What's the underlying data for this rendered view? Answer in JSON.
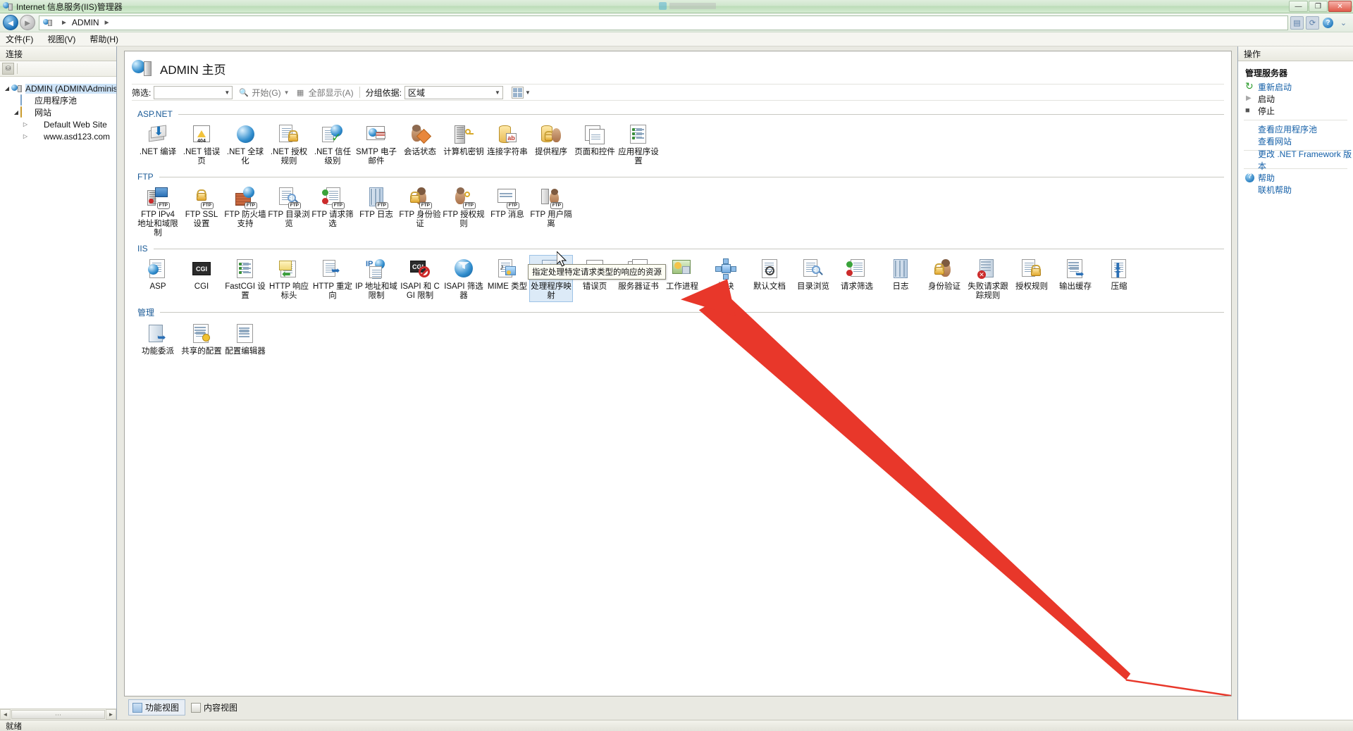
{
  "window": {
    "title": "Internet 信息服务(IIS)管理器",
    "icon": "iis-server-icon",
    "caption_buttons": [
      "minimize",
      "maximize",
      "close"
    ],
    "minimize_glyph": "—",
    "maximize_glyph": "❐",
    "close_glyph": "✕"
  },
  "address_bar": {
    "back_glyph": "◄",
    "forward_glyph": "►",
    "crumb_icon": "server-icon",
    "crumb": "ADMIN",
    "sep_glyph": "►",
    "icons": [
      "panel-icon",
      "refresh-icon",
      "help-icon",
      "chevron-icon"
    ]
  },
  "menu": {
    "items": [
      {
        "label": "文件(F)"
      },
      {
        "label": "视图(V)"
      },
      {
        "label": "帮助(H)"
      }
    ]
  },
  "left_pane": {
    "header": "连接",
    "toolbar_icons": [
      "connect-icon"
    ],
    "tree": [
      {
        "label": "ADMIN (ADMIN\\Administr",
        "icon": "server-icon",
        "depth": 0,
        "expander": "▲",
        "selected": true
      },
      {
        "label": "应用程序池",
        "icon": "app-pool-icon",
        "depth": 1,
        "expander": ""
      },
      {
        "label": "网站",
        "icon": "sites-folder-icon",
        "depth": 1,
        "expander": "▲"
      },
      {
        "label": "Default Web Site",
        "icon": "website-icon",
        "depth": 2,
        "expander": "▷"
      },
      {
        "label": "www.asd123.com",
        "icon": "website-icon",
        "depth": 2,
        "expander": "▷"
      }
    ],
    "hscroll": {
      "left_glyph": "◄",
      "right_glyph": "►",
      "grip": "⋯"
    }
  },
  "main": {
    "page_title": "ADMIN 主页",
    "page_icon": "server-home-icon",
    "filter_bar": {
      "filter_label": "筛选:",
      "filter_value": "",
      "filter_dropdown_glyph": "▼",
      "go_label": "开始(G)",
      "go_icon": "binoculars-icon",
      "go_dropdown_glyph": "▼",
      "show_all_label": "全部显示(A)",
      "show_all_icon": "show-all-icon",
      "group_by_label": "分组依据:",
      "group_by_value": "区域",
      "group_by_dropdown_glyph": "▼",
      "view_dropdown_glyph": "▼"
    },
    "groups": [
      {
        "name": "ASP.NET",
        "items": [
          {
            "label": ".NET 编译",
            "icon": "net-compilation-icon"
          },
          {
            "label": ".NET 错误页",
            "icon": "net-error-pages-icon"
          },
          {
            "label": ".NET 全球化",
            "icon": "net-globalization-icon"
          },
          {
            "label": ".NET 授权规则",
            "icon": "net-authorization-rules-icon"
          },
          {
            "label": ".NET 信任级别",
            "icon": "net-trust-levels-icon"
          },
          {
            "label": "SMTP 电子邮件",
            "icon": "smtp-email-icon"
          },
          {
            "label": "会话状态",
            "icon": "session-state-icon"
          },
          {
            "label": "计算机密钥",
            "icon": "machine-key-icon"
          },
          {
            "label": "连接字符串",
            "icon": "connection-strings-icon"
          },
          {
            "label": "提供程序",
            "icon": "providers-icon"
          },
          {
            "label": "页面和控件",
            "icon": "pages-and-controls-icon"
          },
          {
            "label": "应用程序设置",
            "icon": "application-settings-icon"
          }
        ]
      },
      {
        "name": "FTP",
        "items": [
          {
            "label": "FTP IPv4 地址和域限制",
            "icon": "ftp-ipv4-restrictions-icon"
          },
          {
            "label": "FTP SSL 设置",
            "icon": "ftp-ssl-settings-icon"
          },
          {
            "label": "FTP 防火墙支持",
            "icon": "ftp-firewall-support-icon"
          },
          {
            "label": "FTP 目录浏览",
            "icon": "ftp-directory-browsing-icon"
          },
          {
            "label": "FTP 请求筛选",
            "icon": "ftp-request-filtering-icon"
          },
          {
            "label": "FTP 日志",
            "icon": "ftp-logging-icon"
          },
          {
            "label": "FTP 身份验证",
            "icon": "ftp-authentication-icon"
          },
          {
            "label": "FTP 授权规则",
            "icon": "ftp-authorization-rules-icon"
          },
          {
            "label": "FTP 消息",
            "icon": "ftp-messages-icon"
          },
          {
            "label": "FTP 用户隔离",
            "icon": "ftp-user-isolation-icon"
          }
        ]
      },
      {
        "name": "IIS",
        "items": [
          {
            "label": "ASP",
            "icon": "asp-icon"
          },
          {
            "label": "CGI",
            "icon": "cgi-icon"
          },
          {
            "label": "FastCGI 设置",
            "icon": "fastcgi-settings-icon"
          },
          {
            "label": "HTTP 响应标头",
            "icon": "http-response-headers-icon"
          },
          {
            "label": "HTTP 重定向",
            "icon": "http-redirect-icon"
          },
          {
            "label": "IP 地址和域限制",
            "icon": "ip-domain-restrictions-icon"
          },
          {
            "label": "ISAPI 和 CGI 限制",
            "icon": "isapi-cgi-restrictions-icon"
          },
          {
            "label": "ISAPI 筛选器",
            "icon": "isapi-filters-icon"
          },
          {
            "label": "MIME 类型",
            "icon": "mime-types-icon"
          },
          {
            "label": "处理程序映射",
            "icon": "handler-mappings-icon",
            "selected": true
          },
          {
            "label": "错误页",
            "icon": "error-pages-icon"
          },
          {
            "label": "服务器证书",
            "icon": "server-certificates-icon"
          },
          {
            "label": "工作进程",
            "icon": "worker-processes-icon"
          },
          {
            "label": "模块",
            "icon": "modules-icon"
          },
          {
            "label": "默认文档",
            "icon": "default-document-icon"
          },
          {
            "label": "目录浏览",
            "icon": "directory-browsing-icon"
          },
          {
            "label": "请求筛选",
            "icon": "request-filtering-icon"
          },
          {
            "label": "日志",
            "icon": "logging-icon"
          },
          {
            "label": "身份验证",
            "icon": "authentication-icon"
          },
          {
            "label": "失败请求跟踪规则",
            "icon": "failed-request-tracing-icon"
          },
          {
            "label": "授权规则",
            "icon": "authorization-rules-icon"
          },
          {
            "label": "输出缓存",
            "icon": "output-caching-icon"
          },
          {
            "label": "压缩",
            "icon": "compression-icon"
          }
        ]
      },
      {
        "name": "管理",
        "items": [
          {
            "label": "功能委派",
            "icon": "feature-delegation-icon"
          },
          {
            "label": "共享的配置",
            "icon": "shared-configuration-icon"
          },
          {
            "label": "配置编辑器",
            "icon": "configuration-editor-icon"
          }
        ]
      }
    ],
    "tooltip": "指定处理特定请求类型的响应的资源",
    "view_tabs": [
      {
        "label": "功能视图",
        "icon": "features-view-icon",
        "active": true
      },
      {
        "label": "内容视图",
        "icon": "content-view-icon",
        "active": false
      }
    ]
  },
  "right_pane": {
    "header": "操作",
    "group_title": "管理服务器",
    "items": [
      {
        "label": "重新启动",
        "icon": "restart-icon",
        "link": true
      },
      {
        "label": "启动",
        "icon": "start-icon",
        "link": false
      },
      {
        "label": "停止",
        "icon": "stop-icon",
        "link": false
      },
      {
        "label": "查看应用程序池",
        "icon": "",
        "link": true
      },
      {
        "label": "查看网站",
        "icon": "",
        "link": true
      },
      {
        "label": "更改 .NET Framework 版本",
        "icon": "",
        "link": true
      },
      {
        "label": "帮助",
        "icon": "help-icon",
        "link": true
      },
      {
        "label": "联机帮助",
        "icon": "",
        "link": true
      }
    ]
  },
  "status_bar": {
    "text": "就绪"
  },
  "colors": {
    "accent_link": "#1560a8",
    "group_heading": "#1a5a96",
    "selection": "#dceaf7",
    "selection_border": "#9dc3e6",
    "annotation_arrow": "#e03020",
    "title_bar": "#cfe6cc"
  }
}
